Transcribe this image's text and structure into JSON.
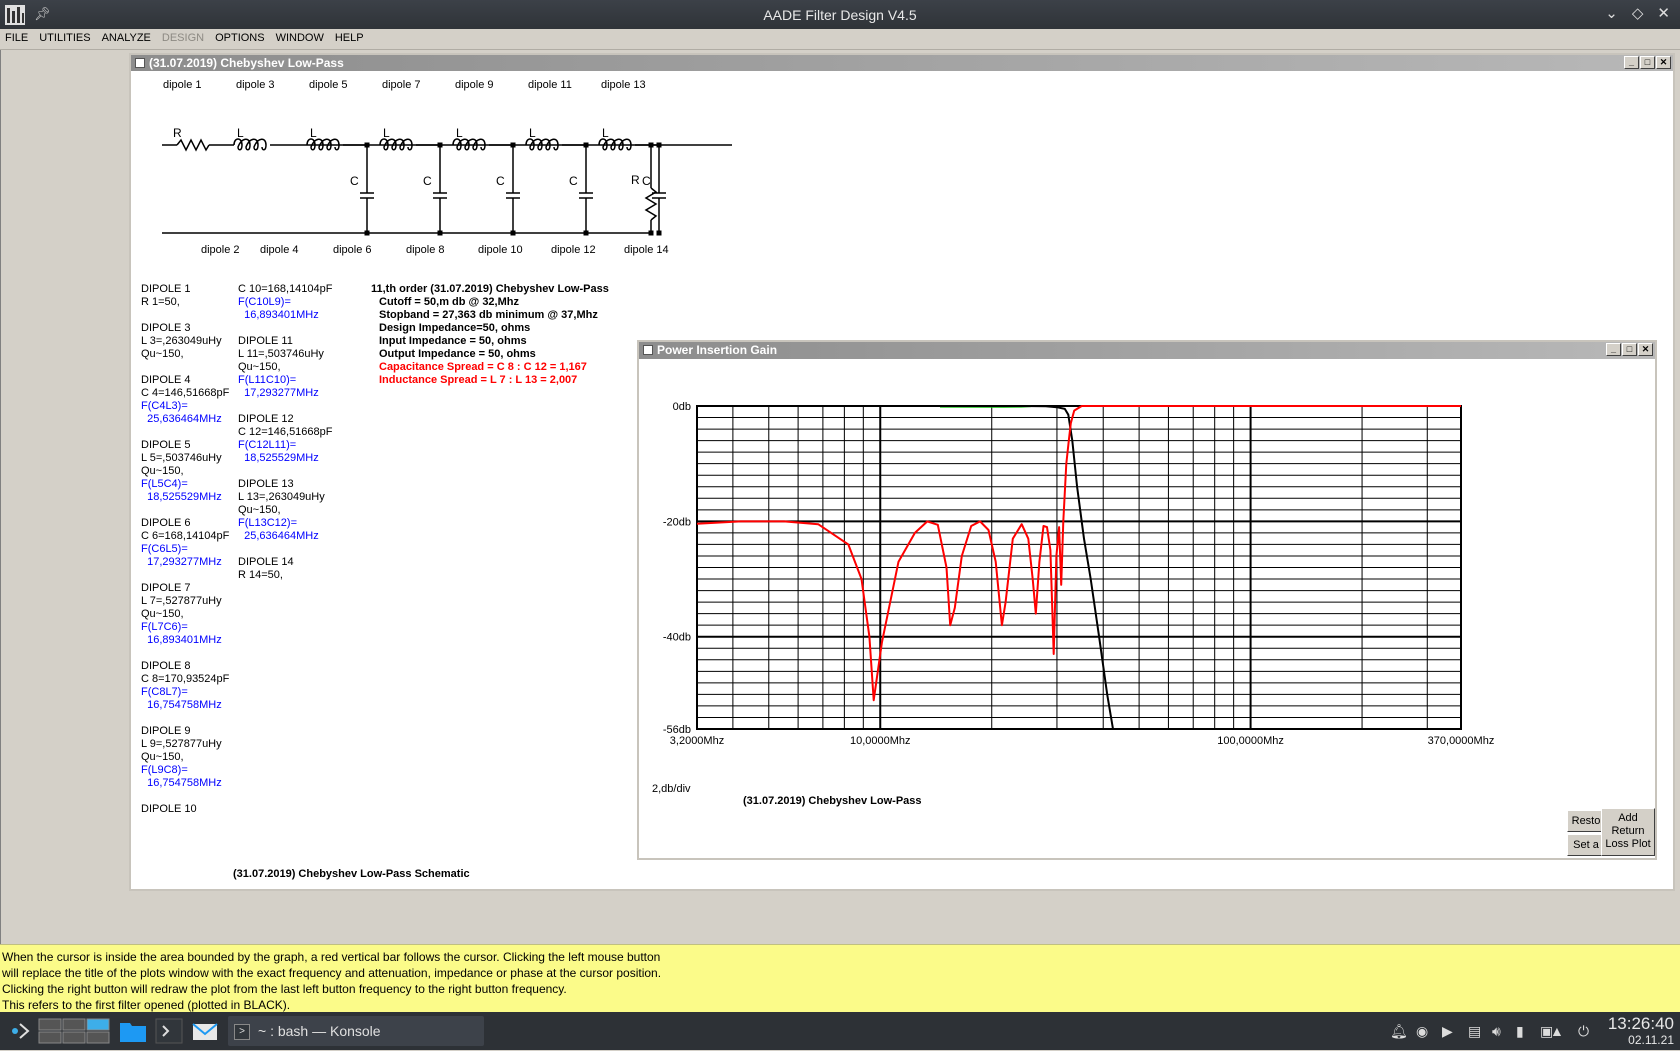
{
  "app": {
    "title": "AADE Filter Design V4.5"
  },
  "menu": [
    {
      "label": "FILE",
      "enabled": true
    },
    {
      "label": "UTILITIES",
      "enabled": true
    },
    {
      "label": "ANALYZE",
      "enabled": true
    },
    {
      "label": "DESIGN",
      "enabled": false
    },
    {
      "label": "OPTIONS",
      "enabled": true
    },
    {
      "label": "WINDOW",
      "enabled": true
    },
    {
      "label": "HELP",
      "enabled": true
    }
  ],
  "schematic": {
    "window_title": "(31.07.2019) Chebyshev Low-Pass",
    "top_labels": [
      "dipole 1",
      "dipole 3",
      "dipole 5",
      "dipole 7",
      "dipole 9",
      "dipole 11",
      "dipole 13"
    ],
    "bottom_labels": [
      "dipole 2",
      "dipole 4",
      "dipole 6",
      "dipole 8",
      "dipole 10",
      "dipole 12",
      "dipole 14"
    ],
    "component_letters": {
      "resistor": "R",
      "inductor": "L",
      "capacitor": "C"
    },
    "caption": "(31.07.2019) Chebyshev Low-Pass Schematic"
  },
  "component_list_col1": [
    {
      "text": "DIPOLE 1",
      "color": "black"
    },
    {
      "text": "R 1=50,",
      "color": "black"
    },
    {
      "text": "",
      "color": "black"
    },
    {
      "text": "DIPOLE 3",
      "color": "black"
    },
    {
      "text": "L 3=,263049uHy",
      "color": "black"
    },
    {
      "text": "Qu~150,",
      "color": "black"
    },
    {
      "text": "",
      "color": "black"
    },
    {
      "text": "DIPOLE 4",
      "color": "black"
    },
    {
      "text": "C 4=146,51668pF",
      "color": "black"
    },
    {
      "text": "F(C4L3)=",
      "color": "blue"
    },
    {
      "text": "  25,636464MHz",
      "color": "blue"
    },
    {
      "text": "",
      "color": "black"
    },
    {
      "text": "DIPOLE 5",
      "color": "black"
    },
    {
      "text": "L 5=,503746uHy",
      "color": "black"
    },
    {
      "text": "Qu~150,",
      "color": "black"
    },
    {
      "text": "F(L5C4)=",
      "color": "blue"
    },
    {
      "text": "  18,525529MHz",
      "color": "blue"
    },
    {
      "text": "",
      "color": "black"
    },
    {
      "text": "DIPOLE 6",
      "color": "black"
    },
    {
      "text": "C 6=168,14104pF",
      "color": "black"
    },
    {
      "text": "F(C6L5)=",
      "color": "blue"
    },
    {
      "text": "  17,293277MHz",
      "color": "blue"
    },
    {
      "text": "",
      "color": "black"
    },
    {
      "text": "DIPOLE 7",
      "color": "black"
    },
    {
      "text": "L 7=,527877uHy",
      "color": "black"
    },
    {
      "text": "Qu~150,",
      "color": "black"
    },
    {
      "text": "F(L7C6)=",
      "color": "blue"
    },
    {
      "text": "  16,893401MHz",
      "color": "blue"
    },
    {
      "text": "",
      "color": "black"
    },
    {
      "text": "DIPOLE 8",
      "color": "black"
    },
    {
      "text": "C 8=170,93524pF",
      "color": "black"
    },
    {
      "text": "F(C8L7)=",
      "color": "blue"
    },
    {
      "text": "  16,754758MHz",
      "color": "blue"
    },
    {
      "text": "",
      "color": "black"
    },
    {
      "text": "DIPOLE 9",
      "color": "black"
    },
    {
      "text": "L 9=,527877uHy",
      "color": "black"
    },
    {
      "text": "Qu~150,",
      "color": "black"
    },
    {
      "text": "F(L9C8)=",
      "color": "blue"
    },
    {
      "text": "  16,754758MHz",
      "color": "blue"
    },
    {
      "text": "",
      "color": "black"
    },
    {
      "text": "DIPOLE 10",
      "color": "black"
    }
  ],
  "component_list_col2": [
    {
      "text": "C 10=168,14104pF",
      "color": "black"
    },
    {
      "text": "F(C10L9)=",
      "color": "blue"
    },
    {
      "text": "  16,893401MHz",
      "color": "blue"
    },
    {
      "text": "",
      "color": "black"
    },
    {
      "text": "DIPOLE 11",
      "color": "black"
    },
    {
      "text": "L 11=,503746uHy",
      "color": "black"
    },
    {
      "text": "Qu~150,",
      "color": "black"
    },
    {
      "text": "F(L11C10)=",
      "color": "blue"
    },
    {
      "text": "  17,293277MHz",
      "color": "blue"
    },
    {
      "text": "",
      "color": "black"
    },
    {
      "text": "DIPOLE 12",
      "color": "black"
    },
    {
      "text": "C 12=146,51668pF",
      "color": "black"
    },
    {
      "text": "F(C12L11)=",
      "color": "blue"
    },
    {
      "text": "  18,525529MHz",
      "color": "blue"
    },
    {
      "text": "",
      "color": "black"
    },
    {
      "text": "DIPOLE 13",
      "color": "black"
    },
    {
      "text": "L 13=,263049uHy",
      "color": "black"
    },
    {
      "text": "Qu~150,",
      "color": "black"
    },
    {
      "text": "F(L13C12)=",
      "color": "blue"
    },
    {
      "text": "  25,636464MHz",
      "color": "blue"
    },
    {
      "text": "",
      "color": "black"
    },
    {
      "text": "DIPOLE 14",
      "color": "black"
    },
    {
      "text": "R 14=50,",
      "color": "black"
    }
  ],
  "summary": {
    "heading": "11,th order (31.07.2019) Chebyshev Low-Pass",
    "lines": [
      {
        "text": "Cutoff = 50,m db @ 32,Mhz",
        "color": "black"
      },
      {
        "text": "Stopband = 27,363 db minimum @ 37,Mhz",
        "color": "black"
      },
      {
        "text": "Design Impedance=50, ohms",
        "color": "black"
      },
      {
        "text": "Input Impedance = 50, ohms",
        "color": "black"
      },
      {
        "text": "Output Impedance = 50, ohms",
        "color": "black"
      },
      {
        "text": "Capacitance Spread = C 8 : C 12 = 1,167",
        "color": "red"
      },
      {
        "text": "Inductance Spread = L 7 : L 13 = 2,007",
        "color": "red"
      }
    ]
  },
  "plot_window": {
    "title": "Power Insertion Gain",
    "scale_label": "2,db/div",
    "plot_title": "(31.07.2019) Chebyshev Low-Pass",
    "buttons": [
      "Resto",
      "Set a",
      "Add\nReturn\nLoss Plot"
    ]
  },
  "chart_data": {
    "type": "line",
    "title": "(31.07.2019) Chebyshev Low-Pass",
    "x_scale": "log",
    "xlim": [
      3.2,
      370
    ],
    "ylim": [
      -56,
      0
    ],
    "x_tick_labels": [
      "3,2000Mhz",
      "10,0000Mhz",
      "100,0000Mhz",
      "370,0000Mhz"
    ],
    "x_tick_values": [
      3.2,
      10,
      100,
      370
    ],
    "y_tick_labels": [
      "0db",
      "-20db",
      "-40db",
      "-56db"
    ],
    "y_tick_values": [
      0,
      -20,
      -40,
      -56
    ],
    "grid": true,
    "series": [
      {
        "color": "#000000",
        "role": "insertion gain",
        "x": [
          3.2,
          5,
          8,
          12,
          18,
          24,
          28,
          30,
          31.5,
          32.2,
          33,
          34,
          35.5,
          37,
          39,
          41,
          42.5
        ],
        "y": [
          0,
          0,
          0,
          0,
          0,
          0,
          -0.05,
          -0.2,
          -0.5,
          -1.5,
          -6,
          -14,
          -23,
          -30,
          -40,
          -50,
          -56
        ]
      },
      {
        "color": "#ff0000",
        "role": "return loss",
        "x": [
          3.2,
          4.2,
          5.5,
          6.8,
          8.2,
          8.9,
          9.35,
          9.6,
          10.1,
          11.2,
          12.4,
          13.4,
          14.3,
          15.1,
          15.45,
          15.9,
          16.6,
          17.6,
          18.6,
          19.6,
          20.5,
          21.3,
          21.8,
          22.8,
          24.1,
          25.1,
          25.8,
          26.3,
          26.9,
          27.6,
          28.2,
          28.8,
          29.4,
          29.9,
          30.4,
          30.8,
          31.2,
          31.8,
          32.3,
          32.7,
          33.4,
          35,
          60,
          370
        ],
        "y": [
          -20.4,
          -20,
          -20,
          -20.5,
          -24,
          -30,
          -40,
          -51,
          -41,
          -27,
          -22,
          -20,
          -20.6,
          -28,
          -38,
          -35,
          -26,
          -20.8,
          -20,
          -21.5,
          -27,
          -38,
          -34,
          -23,
          -20.5,
          -23,
          -30,
          -36,
          -27,
          -20.8,
          -21,
          -25,
          -43,
          -26,
          -21,
          -31,
          -20,
          -10,
          -6,
          -3,
          -0.8,
          0,
          0,
          0
        ]
      },
      {
        "color": "#00c000",
        "role": "passband",
        "x": [
          14.5,
          21.5,
          24,
          25.5
        ],
        "y": [
          -0.1,
          -0.12,
          -0.1,
          -0.02
        ]
      }
    ]
  },
  "help_text": [
    "When the cursor is inside the area bounded by the graph, a red vertical bar follows the cursor. Clicking the left mouse button",
    "will replace the title of the plots window with the exact frequency and attenuation, impedance or phase at the cursor position.",
    "Clicking the right button will redraw the plot from the last left button frequency to the right button frequency.",
    "This refers to the first filter opened (plotted in BLACK)."
  ],
  "taskbar": {
    "task_label": "~ : bash — Konsole",
    "time": "13:26:40",
    "date": "02.11.21"
  }
}
